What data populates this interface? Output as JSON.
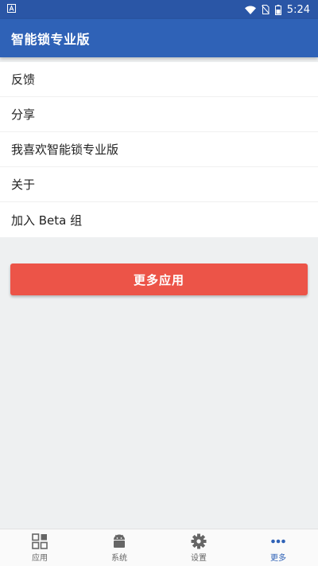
{
  "status_bar": {
    "time": "5:24",
    "icons": [
      "notification-a-icon",
      "wifi-icon",
      "no-sim-icon",
      "battery-icon"
    ]
  },
  "app_bar": {
    "title": "智能锁专业版"
  },
  "menu": {
    "items": [
      {
        "label": "反馈"
      },
      {
        "label": "分享"
      },
      {
        "label": "我喜欢智能锁专业版"
      },
      {
        "label": "关于"
      },
      {
        "label": "加入 Beta 组"
      }
    ]
  },
  "more_apps_button": {
    "label": "更多应用"
  },
  "bottom_nav": {
    "items": [
      {
        "label": "应用",
        "icon": "apps-grid-icon"
      },
      {
        "label": "系统",
        "icon": "android-icon"
      },
      {
        "label": "设置",
        "icon": "gear-icon"
      },
      {
        "label": "更多",
        "icon": "more-dots-icon"
      }
    ],
    "active_index": 3
  },
  "colors": {
    "primary": "#2f62b7",
    "status_bar": "#2a56a6",
    "accent_button": "#ec5448",
    "background": "#eef0f1"
  }
}
